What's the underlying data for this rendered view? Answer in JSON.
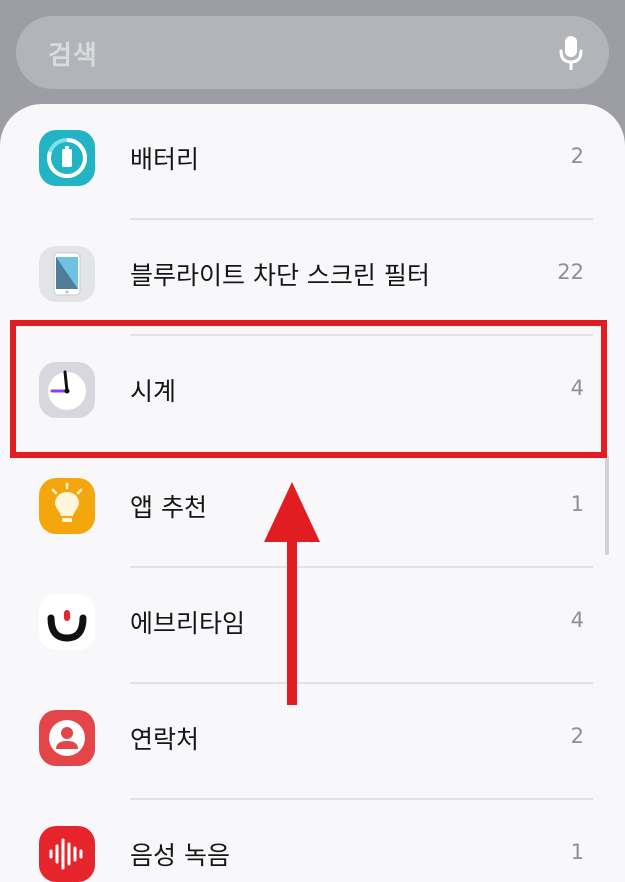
{
  "search": {
    "placeholder": "검색",
    "mic_icon": "microphone-icon"
  },
  "apps": [
    {
      "name": "배터리",
      "count": "2",
      "icon": "battery-icon",
      "color": "#22b3c4"
    },
    {
      "name": "블루라이트 차단 스크린 필터",
      "count": "22",
      "icon": "phone-screen-icon",
      "color": "#e3e4e7"
    },
    {
      "name": "시계",
      "count": "4",
      "icon": "clock-icon",
      "color": "#d6d8dd"
    },
    {
      "name": "앱 추천",
      "count": "1",
      "icon": "lightbulb-icon",
      "color": "#f3a70d"
    },
    {
      "name": "에브리타임",
      "count": "4",
      "icon": "everytime-logo-icon",
      "color": "#ffffff"
    },
    {
      "name": "연락처",
      "count": "2",
      "icon": "contact-icon",
      "color": "#e44549"
    },
    {
      "name": "음성 녹음",
      "count": "1",
      "icon": "voice-recorder-icon",
      "color": "#e5252b"
    }
  ],
  "annotation": {
    "highlight_color": "#e11d22",
    "arrow_icon": "up-arrow-icon"
  }
}
